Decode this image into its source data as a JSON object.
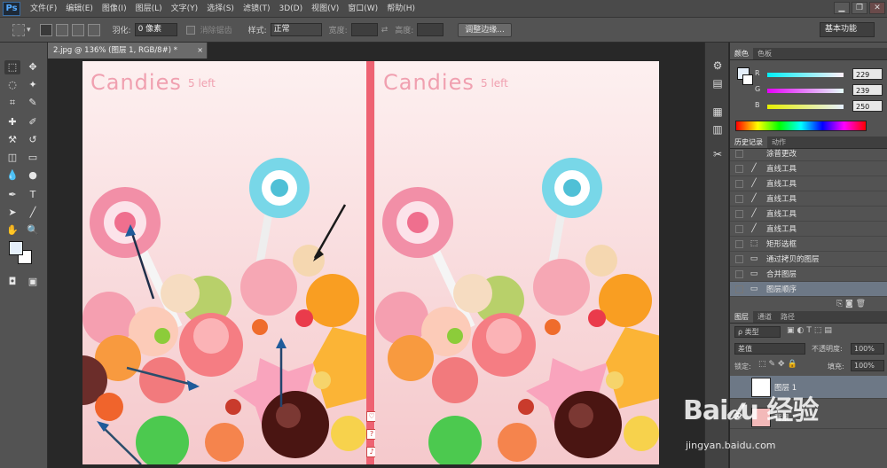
{
  "app": {
    "logo": "Ps"
  },
  "menu": [
    "文件(F)",
    "编辑(E)",
    "图像(I)",
    "图层(L)",
    "文字(Y)",
    "选择(S)",
    "滤镜(T)",
    "3D(D)",
    "视图(V)",
    "窗口(W)",
    "帮助(H)"
  ],
  "window_controls": {
    "minimize": "▁",
    "restore": "❐",
    "close": "✕"
  },
  "options": {
    "feather_label": "羽化:",
    "feather_value": "0 像素",
    "antialias_label": "消除锯齿",
    "style_label": "样式:",
    "style_value": "正常",
    "width_label": "宽度:",
    "height_label": "高度:",
    "refine_button": "调整边缘...",
    "workspace": "基本功能"
  },
  "document": {
    "tab_title": "2.jpg @ 136% (图层 1, RGB/8#) *",
    "close": "×"
  },
  "canvas": {
    "title": "Candies",
    "subtitle": "5 left",
    "side_icons": [
      "♡",
      "?",
      "♪"
    ]
  },
  "color_panel": {
    "tabs": [
      "颜色",
      "色板"
    ],
    "r": {
      "label": "R",
      "value": "229"
    },
    "g": {
      "label": "G",
      "value": "239"
    },
    "b": {
      "label": "B",
      "value": "250"
    },
    "colors": {
      "r_bar": "#e5e5ef",
      "fg": "#e5effa"
    }
  },
  "history_panel": {
    "tabs": [
      "历史记录",
      "动作"
    ],
    "items": [
      "涂普更改",
      "直线工具",
      "直线工具",
      "直线工具",
      "直线工具",
      "直线工具",
      "矩形选框",
      "通过拷贝的图层",
      "合并图层",
      "图层顺序"
    ]
  },
  "layers_panel": {
    "tabs": [
      "图层",
      "通道",
      "路径"
    ],
    "kind": "ρ 类型",
    "blend": "差值",
    "opacity_label": "不透明度:",
    "opacity_value": "100%",
    "lock_label": "锁定:",
    "fill_label": "填充:",
    "fill_value": "100%",
    "layers": [
      "图层 1",
      "背景"
    ]
  },
  "watermark": {
    "text": "Bai𝒹u 经验",
    "sub": "jingyan.baidu.com"
  }
}
